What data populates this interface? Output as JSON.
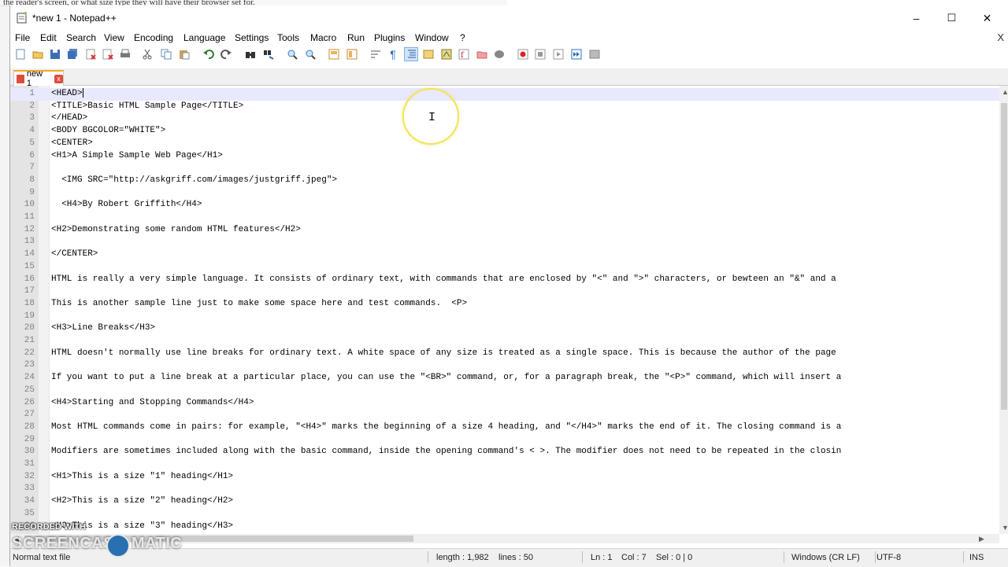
{
  "background_doc": {
    "strip_text": "the reader's screen, or what size type they will have their browser set for."
  },
  "window": {
    "title": "*new 1 - Notepad++",
    "minimize": "–",
    "maximize": "☐",
    "close": "✕"
  },
  "menu": {
    "items": [
      "File",
      "Edit",
      "Search",
      "View",
      "Encoding",
      "Language",
      "Settings",
      "Tools",
      "Macro",
      "Run",
      "Plugins",
      "Window",
      "?"
    ],
    "close_glyph": "X"
  },
  "toolbar_icons": [
    "new-file",
    "open-file",
    "save",
    "save-all",
    "close",
    "close-all",
    "print",
    "cut",
    "copy",
    "paste",
    "undo",
    "redo",
    "find",
    "replace",
    "zoom-in",
    "zoom-out",
    "sync-vertical",
    "sync-horizontal",
    "word-wrap",
    "show-all-chars",
    "indent-guide",
    "udl",
    "doc-map",
    "function-list",
    "folder-workspace",
    "monitoring",
    "record-macro",
    "stop-record",
    "playback",
    "run-multiple",
    "save-macro"
  ],
  "tab": {
    "label": "new 1",
    "close_glyph": "x"
  },
  "editor": {
    "current_line": 1,
    "lines": [
      {
        "n": "1",
        "t": "<HEAD>"
      },
      {
        "n": "2",
        "t": "<TITLE>Basic HTML Sample Page</TITLE>"
      },
      {
        "n": "3",
        "t": "</HEAD>"
      },
      {
        "n": "4",
        "t": "<BODY BGCOLOR=\"WHITE\">"
      },
      {
        "n": "5",
        "t": "<CENTER>"
      },
      {
        "n": "6",
        "t": "<H1>A Simple Sample Web Page</H1>"
      },
      {
        "n": "7",
        "t": ""
      },
      {
        "n": "8",
        "t": "  <IMG SRC=\"http://askgriff.com/images/justgriff.jpeg\">"
      },
      {
        "n": "9",
        "t": ""
      },
      {
        "n": "10",
        "t": "  <H4>By Robert Griffith</H4>"
      },
      {
        "n": "11",
        "t": ""
      },
      {
        "n": "12",
        "t": "<H2>Demonstrating some random HTML features</H2>"
      },
      {
        "n": "13",
        "t": ""
      },
      {
        "n": "14",
        "t": "</CENTER>"
      },
      {
        "n": "15",
        "t": ""
      },
      {
        "n": "16",
        "t": "HTML is really a very simple language. It consists of ordinary text, with commands that are enclosed by \"<\" and \">\" characters, or bewteen an \"&\" and a"
      },
      {
        "n": "17",
        "t": ""
      },
      {
        "n": "18",
        "t": "This is another sample line just to make some space here and test commands.  <P>"
      },
      {
        "n": "19",
        "t": ""
      },
      {
        "n": "20",
        "t": "<H3>Line Breaks</H3>"
      },
      {
        "n": "21",
        "t": ""
      },
      {
        "n": "22",
        "t": "HTML doesn't normally use line breaks for ordinary text. A white space of any size is treated as a single space. This is because the author of the page"
      },
      {
        "n": "23",
        "t": ""
      },
      {
        "n": "24",
        "t": "If you want to put a line break at a particular place, you can use the \"<BR>\" command, or, for a paragraph break, the \"<P>\" command, which will insert a"
      },
      {
        "n": "25",
        "t": ""
      },
      {
        "n": "26",
        "t": "<H4>Starting and Stopping Commands</H4>"
      },
      {
        "n": "27",
        "t": ""
      },
      {
        "n": "28",
        "t": "Most HTML commands come in pairs: for example, \"<H4>\" marks the beginning of a size 4 heading, and \"</H4>\" marks the end of it. The closing command is a"
      },
      {
        "n": "29",
        "t": ""
      },
      {
        "n": "30",
        "t": "Modifiers are sometimes included along with the basic command, inside the opening command's < >. The modifier does not need to be repeated in the closin"
      },
      {
        "n": "31",
        "t": ""
      },
      {
        "n": "32",
        "t": "<H1>This is a size \"1\" heading</H1>"
      },
      {
        "n": "33",
        "t": ""
      },
      {
        "n": "34",
        "t": "<H2>This is a size \"2\" heading</H2>"
      },
      {
        "n": "35",
        "t": ""
      },
      {
        "n": "36",
        "t": "<H3>This is a size \"3\" heading</H3>"
      }
    ]
  },
  "status": {
    "file_type": "Normal text file",
    "length": "length : 1,982",
    "lines": "lines : 50",
    "ln": "Ln : 1",
    "col": "Col : 7",
    "sel": "Sel : 0 | 0",
    "eol": "Windows (CR LF)",
    "encoding": "UTF-8",
    "mode": "INS"
  },
  "watermark": {
    "top": "RECORDED WITH",
    "main": "SCREENCAST",
    "suffix": "MATIC"
  },
  "colors": {
    "tab_accent": "#f5a623",
    "current_line": "#e8e8ff",
    "gutter": "#e4e4e4",
    "cursor_ring": "#f3e45b"
  }
}
